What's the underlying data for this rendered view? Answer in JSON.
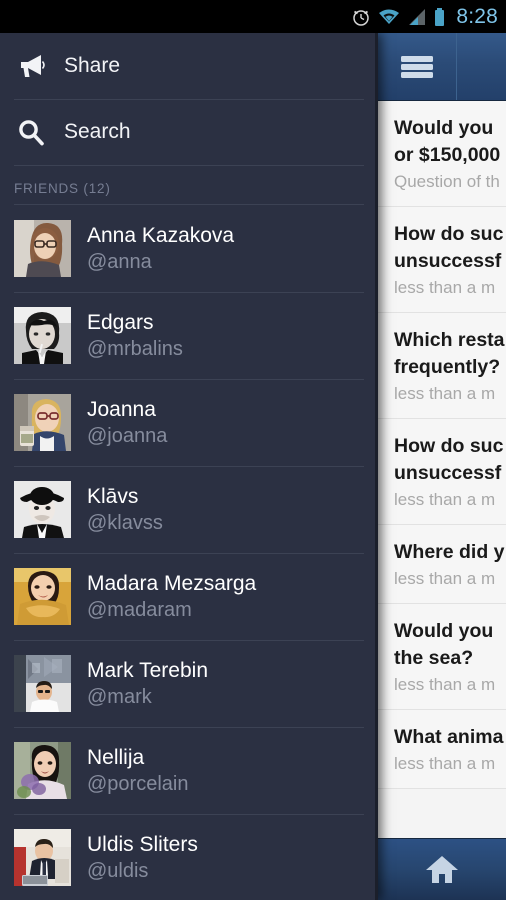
{
  "statusbar": {
    "time": "8:28",
    "icons": [
      "alarm-clock-icon",
      "wifi-icon",
      "cellular-signal-icon",
      "battery-icon"
    ]
  },
  "drawer": {
    "nav": [
      {
        "label": "Share",
        "icon": "megaphone-icon"
      },
      {
        "label": "Search",
        "icon": "search-icon"
      }
    ],
    "friends_header": "FRIENDS (12)",
    "friends": [
      {
        "name": "Anna Kazakova",
        "handle": "@anna"
      },
      {
        "name": "Edgars",
        "handle": "@mrbalins"
      },
      {
        "name": "Joanna",
        "handle": "@joanna"
      },
      {
        "name": "Klāvs",
        "handle": "@klavss"
      },
      {
        "name": "Madara Mezsarga",
        "handle": "@madaram"
      },
      {
        "name": "Mark Terebin",
        "handle": "@mark"
      },
      {
        "name": "Nellija",
        "handle": "@porcelain"
      },
      {
        "name": "Uldis Sliters",
        "handle": "@uldis"
      }
    ]
  },
  "content": {
    "appbar": {
      "menu_icon": "hamburger-menu-icon"
    },
    "questions": [
      {
        "title_line1": "Would you",
        "title_line2": "or $150,000",
        "sub": "Question of th"
      },
      {
        "title_line1": "How do suc",
        "title_line2": "unsuccessf",
        "sub": "less than a m"
      },
      {
        "title_line1": "Which resta",
        "title_line2": "frequently?",
        "sub": "less than a m"
      },
      {
        "title_line1": "How do suc",
        "title_line2": "unsuccessf",
        "sub": "less than a m"
      },
      {
        "title_line1": "Where did y",
        "title_line2": "",
        "sub": "less than a m"
      },
      {
        "title_line1": "Would you",
        "title_line2": "the sea?",
        "sub": "less than a m"
      },
      {
        "title_line1": "What anima",
        "title_line2": "",
        "sub": "less than a m"
      }
    ],
    "bottombar": {
      "home_icon": "home-icon"
    }
  },
  "colors": {
    "drawer_bg": "#2b3042",
    "appbar_blue": "#2b4b77",
    "content_bg": "#f4f4f4",
    "status_time": "#7fc4e8",
    "handle_gray": "#868c9d"
  }
}
